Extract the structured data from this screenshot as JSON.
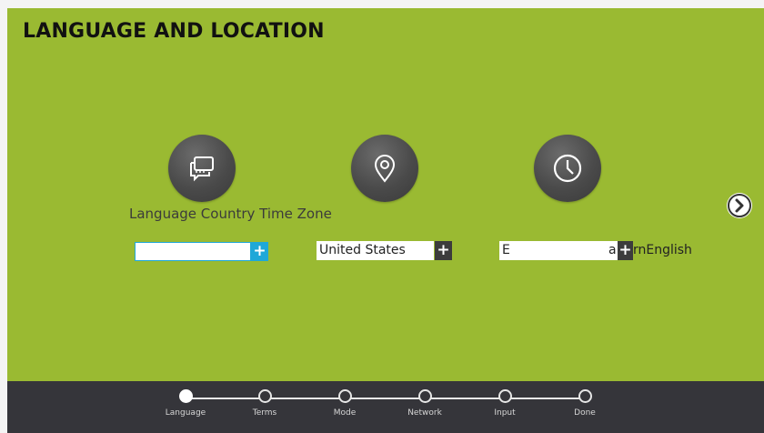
{
  "page": {
    "title": "LANGUAGE AND LOCATION"
  },
  "sections": {
    "labels": "Language Country Time Zone",
    "language": {
      "value": "",
      "add": "+"
    },
    "country": {
      "value": "United States",
      "add": "+"
    },
    "timezone": {
      "value": "E",
      "add": "+",
      "trailing": "a",
      "after": "rnEnglish"
    }
  },
  "icons": [
    "chat-icon",
    "location-pin-icon",
    "clock-icon",
    "chevron-right-icon"
  ],
  "colors": {
    "background": "#9aba32",
    "footer": "#35353a",
    "accent": "#1fa8d8"
  },
  "steps": [
    {
      "label": "Language",
      "active": true
    },
    {
      "label": "Terms",
      "active": false
    },
    {
      "label": "Mode",
      "active": false
    },
    {
      "label": "Network",
      "active": false
    },
    {
      "label": "Input",
      "active": false
    },
    {
      "label": "Done",
      "active": false
    }
  ]
}
